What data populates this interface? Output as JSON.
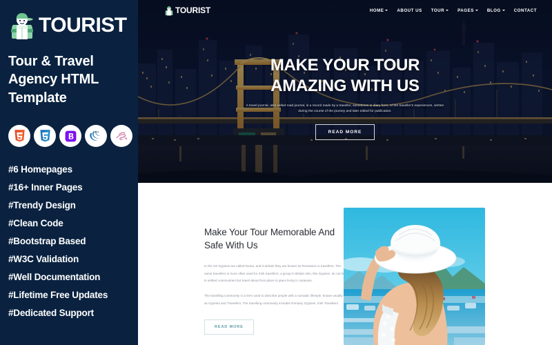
{
  "sidebar": {
    "brand": {
      "name": "TOURIST",
      "logo_icon": "hiker-backpacker-icon"
    },
    "tagline": "Tour & Travel Agency  HTML Template",
    "tech_icons": [
      {
        "name": "html5-icon",
        "label": "HTML5",
        "color": "#e44d26"
      },
      {
        "name": "css3-icon",
        "label": "CSS3",
        "color": "#1b73ba"
      },
      {
        "name": "bootstrap-icon",
        "label": "B",
        "color": "#7b10f0"
      },
      {
        "name": "jquery-icon",
        "label": "jQuery",
        "color": "#0868ac"
      },
      {
        "name": "sass-icon",
        "label": "Sass",
        "color": "#cd6799"
      }
    ],
    "features": [
      "#6 Homepages",
      "#16+ Inner Pages",
      "#Trendy Design",
      "#Clean Code",
      "#Bootstrap Based",
      "#W3C Validation",
      "#Well Documentation",
      "#Lifetime Free Updates",
      "#Dedicated Support"
    ],
    "background_color": "#0a2240"
  },
  "navbar": {
    "brand": "TOURIST",
    "items": [
      {
        "label": "HOME",
        "has_dropdown": true
      },
      {
        "label": "ABOUT US",
        "has_dropdown": false
      },
      {
        "label": "TOUR",
        "has_dropdown": true
      },
      {
        "label": "PAGES",
        "has_dropdown": true
      },
      {
        "label": "BLOG",
        "has_dropdown": true
      },
      {
        "label": "CONTACT",
        "has_dropdown": false
      }
    ]
  },
  "hero": {
    "title": "MAKE YOUR TOUR AMAZING WITH US",
    "subtitle": "A travel journal, also called road journal, is a record made by a traveller, sometimes in diary form, of the traveller's experiences, written during the course of the journey and later edited for publication.",
    "button_label": "READ MORE",
    "image_alt": "night-cityscape-illuminated-suspension-bridge"
  },
  "about": {
    "title": "Make Your Tour Memorable And Safe With Us",
    "paragraph_1": "In the US Gypsies are called Roma, and in Britain they are known as Romanies or travellers. The name travellers is more often used for Irish travellers, a group in Britain who, like Gypsies, do not live in settled communities but travel about from place to place living in caravans.",
    "paragraph_2": "The travelling community is a term used to describe people with a nomadic lifestyle, known usually as Gypsies and Travellers. The travelling community includes Romany Gypsies, Irish Travellers.",
    "button_label": "READ MORE",
    "image_alt": "woman-white-sun-hat-harbor-view",
    "accent_color": "#5c9ba3"
  }
}
